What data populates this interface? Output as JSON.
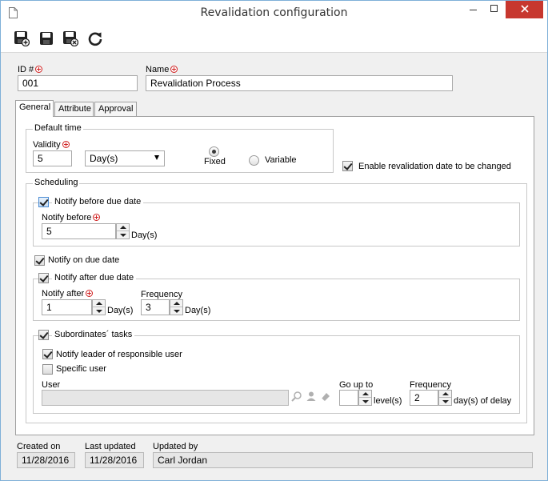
{
  "window": {
    "title": "Revalidation configuration",
    "icons": {
      "app": "document-icon",
      "minimize": "minimize-icon",
      "maximize": "maximize-icon",
      "close": "close-icon"
    }
  },
  "toolbar": {
    "buttons": [
      {
        "name": "save-and-new",
        "icon": "save-new-icon"
      },
      {
        "name": "save",
        "icon": "save-icon"
      },
      {
        "name": "save-and-close",
        "icon": "save-close-icon"
      },
      {
        "name": "refresh",
        "icon": "refresh-icon"
      }
    ]
  },
  "header": {
    "id_label": "ID #",
    "id_value": "001",
    "name_label": "Name",
    "name_value": "Revalidation Process"
  },
  "tabs": [
    {
      "label": "General",
      "active": true
    },
    {
      "label": "Attribute",
      "active": false
    },
    {
      "label": "Approval",
      "active": false
    }
  ],
  "general": {
    "default_time": {
      "legend": "Default time",
      "validity_label": "Validity",
      "validity_value": "5",
      "unit_value": "Day(s)",
      "fixed_label": "Fixed",
      "variable_label": "Variable",
      "selected_mode": "Fixed"
    },
    "enable_change": {
      "label": "Enable revalidation date to be changed",
      "checked": true
    },
    "scheduling": {
      "legend": "Scheduling",
      "notify_before": {
        "label": "Notify before due date",
        "checked": true,
        "field_label": "Notify before",
        "value": "5",
        "unit": "Day(s)"
      },
      "notify_on_due": {
        "label": "Notify on due date",
        "checked": true
      },
      "notify_after": {
        "label": "Notify after due date",
        "checked": true,
        "field_label": "Notify after",
        "value": "1",
        "unit": "Day(s)",
        "frequency_label": "Frequency",
        "frequency_value": "3",
        "frequency_unit": "Day(s)"
      },
      "subordinates": {
        "label": "Subordinates´ tasks",
        "checked": true,
        "notify_leader": {
          "label": "Notify leader of responsible user",
          "checked": true
        },
        "specific_user": {
          "label": "Specific user",
          "checked": false
        },
        "user_label": "User",
        "user_value": "",
        "go_up_to_label": "Go up to",
        "go_up_to_value": "",
        "levels_unit": "level(s)",
        "frequency_label": "Frequency",
        "frequency_value": "2",
        "frequency_unit": "day(s) of delay"
      }
    }
  },
  "footer": {
    "created_on_label": "Created on",
    "created_on_value": "11/28/2016",
    "last_updated_label": "Last updated",
    "last_updated_value": "11/28/2016",
    "updated_by_label": "Updated by",
    "updated_by_value": "Carl Jordan"
  }
}
